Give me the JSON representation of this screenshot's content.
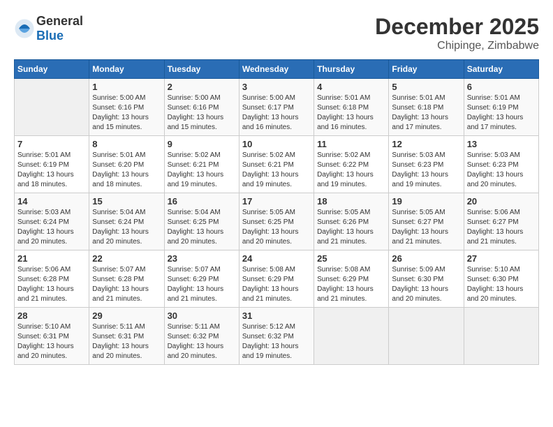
{
  "header": {
    "logo_general": "General",
    "logo_blue": "Blue",
    "month_year": "December 2025",
    "location": "Chipinge, Zimbabwe"
  },
  "days_of_week": [
    "Sunday",
    "Monday",
    "Tuesday",
    "Wednesday",
    "Thursday",
    "Friday",
    "Saturday"
  ],
  "weeks": [
    [
      {
        "day": "",
        "sunrise": "",
        "sunset": "",
        "daylight": ""
      },
      {
        "day": "1",
        "sunrise": "Sunrise: 5:00 AM",
        "sunset": "Sunset: 6:16 PM",
        "daylight": "Daylight: 13 hours and 15 minutes."
      },
      {
        "day": "2",
        "sunrise": "Sunrise: 5:00 AM",
        "sunset": "Sunset: 6:16 PM",
        "daylight": "Daylight: 13 hours and 15 minutes."
      },
      {
        "day": "3",
        "sunrise": "Sunrise: 5:00 AM",
        "sunset": "Sunset: 6:17 PM",
        "daylight": "Daylight: 13 hours and 16 minutes."
      },
      {
        "day": "4",
        "sunrise": "Sunrise: 5:01 AM",
        "sunset": "Sunset: 6:18 PM",
        "daylight": "Daylight: 13 hours and 16 minutes."
      },
      {
        "day": "5",
        "sunrise": "Sunrise: 5:01 AM",
        "sunset": "Sunset: 6:18 PM",
        "daylight": "Daylight: 13 hours and 17 minutes."
      },
      {
        "day": "6",
        "sunrise": "Sunrise: 5:01 AM",
        "sunset": "Sunset: 6:19 PM",
        "daylight": "Daylight: 13 hours and 17 minutes."
      }
    ],
    [
      {
        "day": "7",
        "sunrise": "Sunrise: 5:01 AM",
        "sunset": "Sunset: 6:19 PM",
        "daylight": "Daylight: 13 hours and 18 minutes."
      },
      {
        "day": "8",
        "sunrise": "Sunrise: 5:01 AM",
        "sunset": "Sunset: 6:20 PM",
        "daylight": "Daylight: 13 hours and 18 minutes."
      },
      {
        "day": "9",
        "sunrise": "Sunrise: 5:02 AM",
        "sunset": "Sunset: 6:21 PM",
        "daylight": "Daylight: 13 hours and 19 minutes."
      },
      {
        "day": "10",
        "sunrise": "Sunrise: 5:02 AM",
        "sunset": "Sunset: 6:21 PM",
        "daylight": "Daylight: 13 hours and 19 minutes."
      },
      {
        "day": "11",
        "sunrise": "Sunrise: 5:02 AM",
        "sunset": "Sunset: 6:22 PM",
        "daylight": "Daylight: 13 hours and 19 minutes."
      },
      {
        "day": "12",
        "sunrise": "Sunrise: 5:03 AM",
        "sunset": "Sunset: 6:23 PM",
        "daylight": "Daylight: 13 hours and 19 minutes."
      },
      {
        "day": "13",
        "sunrise": "Sunrise: 5:03 AM",
        "sunset": "Sunset: 6:23 PM",
        "daylight": "Daylight: 13 hours and 20 minutes."
      }
    ],
    [
      {
        "day": "14",
        "sunrise": "Sunrise: 5:03 AM",
        "sunset": "Sunset: 6:24 PM",
        "daylight": "Daylight: 13 hours and 20 minutes."
      },
      {
        "day": "15",
        "sunrise": "Sunrise: 5:04 AM",
        "sunset": "Sunset: 6:24 PM",
        "daylight": "Daylight: 13 hours and 20 minutes."
      },
      {
        "day": "16",
        "sunrise": "Sunrise: 5:04 AM",
        "sunset": "Sunset: 6:25 PM",
        "daylight": "Daylight: 13 hours and 20 minutes."
      },
      {
        "day": "17",
        "sunrise": "Sunrise: 5:05 AM",
        "sunset": "Sunset: 6:25 PM",
        "daylight": "Daylight: 13 hours and 20 minutes."
      },
      {
        "day": "18",
        "sunrise": "Sunrise: 5:05 AM",
        "sunset": "Sunset: 6:26 PM",
        "daylight": "Daylight: 13 hours and 21 minutes."
      },
      {
        "day": "19",
        "sunrise": "Sunrise: 5:05 AM",
        "sunset": "Sunset: 6:27 PM",
        "daylight": "Daylight: 13 hours and 21 minutes."
      },
      {
        "day": "20",
        "sunrise": "Sunrise: 5:06 AM",
        "sunset": "Sunset: 6:27 PM",
        "daylight": "Daylight: 13 hours and 21 minutes."
      }
    ],
    [
      {
        "day": "21",
        "sunrise": "Sunrise: 5:06 AM",
        "sunset": "Sunset: 6:28 PM",
        "daylight": "Daylight: 13 hours and 21 minutes."
      },
      {
        "day": "22",
        "sunrise": "Sunrise: 5:07 AM",
        "sunset": "Sunset: 6:28 PM",
        "daylight": "Daylight: 13 hours and 21 minutes."
      },
      {
        "day": "23",
        "sunrise": "Sunrise: 5:07 AM",
        "sunset": "Sunset: 6:29 PM",
        "daylight": "Daylight: 13 hours and 21 minutes."
      },
      {
        "day": "24",
        "sunrise": "Sunrise: 5:08 AM",
        "sunset": "Sunset: 6:29 PM",
        "daylight": "Daylight: 13 hours and 21 minutes."
      },
      {
        "day": "25",
        "sunrise": "Sunrise: 5:08 AM",
        "sunset": "Sunset: 6:29 PM",
        "daylight": "Daylight: 13 hours and 21 minutes."
      },
      {
        "day": "26",
        "sunrise": "Sunrise: 5:09 AM",
        "sunset": "Sunset: 6:30 PM",
        "daylight": "Daylight: 13 hours and 20 minutes."
      },
      {
        "day": "27",
        "sunrise": "Sunrise: 5:10 AM",
        "sunset": "Sunset: 6:30 PM",
        "daylight": "Daylight: 13 hours and 20 minutes."
      }
    ],
    [
      {
        "day": "28",
        "sunrise": "Sunrise: 5:10 AM",
        "sunset": "Sunset: 6:31 PM",
        "daylight": "Daylight: 13 hours and 20 minutes."
      },
      {
        "day": "29",
        "sunrise": "Sunrise: 5:11 AM",
        "sunset": "Sunset: 6:31 PM",
        "daylight": "Daylight: 13 hours and 20 minutes."
      },
      {
        "day": "30",
        "sunrise": "Sunrise: 5:11 AM",
        "sunset": "Sunset: 6:32 PM",
        "daylight": "Daylight: 13 hours and 20 minutes."
      },
      {
        "day": "31",
        "sunrise": "Sunrise: 5:12 AM",
        "sunset": "Sunset: 6:32 PM",
        "daylight": "Daylight: 13 hours and 19 minutes."
      },
      {
        "day": "",
        "sunrise": "",
        "sunset": "",
        "daylight": ""
      },
      {
        "day": "",
        "sunrise": "",
        "sunset": "",
        "daylight": ""
      },
      {
        "day": "",
        "sunrise": "",
        "sunset": "",
        "daylight": ""
      }
    ]
  ]
}
